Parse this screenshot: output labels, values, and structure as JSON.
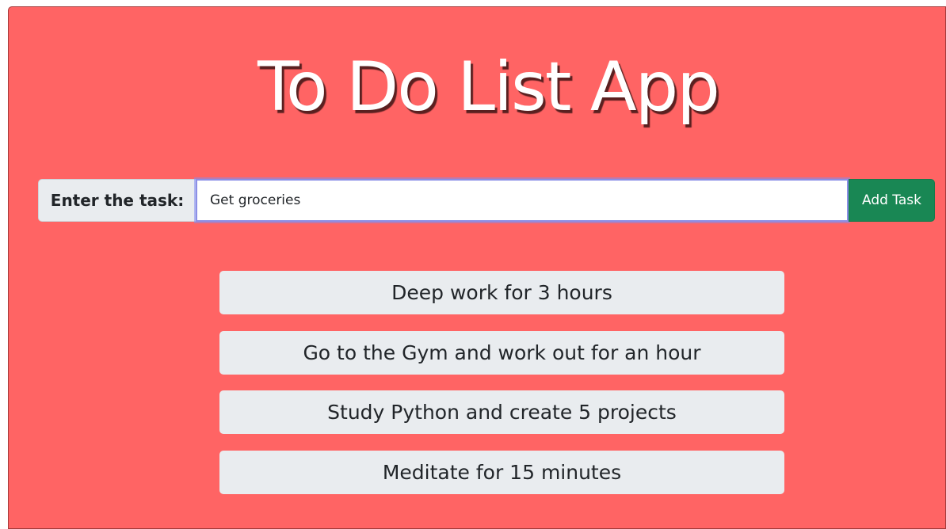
{
  "app": {
    "title": "To Do List App",
    "background_color": "#ff6464"
  },
  "form": {
    "label": "Enter the task:",
    "input_value": "Get groceries",
    "add_button_label": "Add Task",
    "add_button_color": "#198754"
  },
  "tasks": [
    {
      "text": "Deep work for 3 hours"
    },
    {
      "text": "Go to the Gym and work out for an hour"
    },
    {
      "text": "Study Python and create 5 projects"
    },
    {
      "text": "Meditate for 15 minutes"
    }
  ]
}
